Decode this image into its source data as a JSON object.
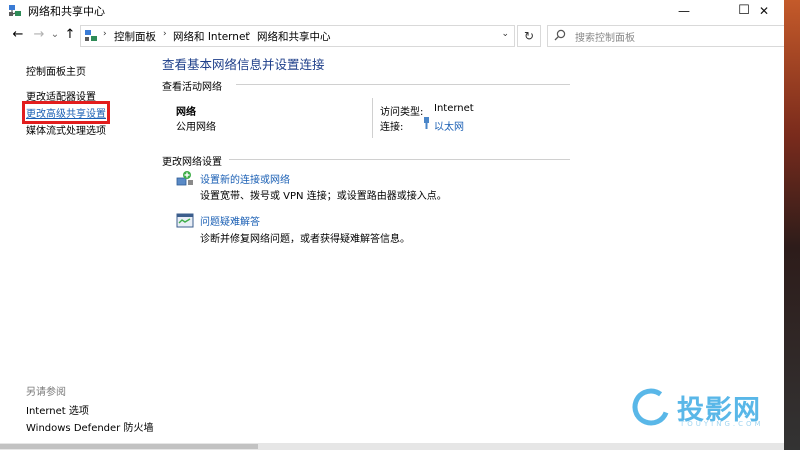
{
  "window": {
    "title": "网络和共享中心"
  },
  "controls": {
    "minimize": "—",
    "maximize": "☐",
    "close": "✕"
  },
  "nav": {
    "back": "←",
    "forward": "→",
    "history": "⌄",
    "up": "↑"
  },
  "address": {
    "crumbs": [
      "控制面板",
      "网络和 Internet",
      "网络和共享中心"
    ],
    "separator": "›",
    "dropdown": "⌄",
    "refresh": "↻"
  },
  "search": {
    "placeholder": "搜索控制面板"
  },
  "left": {
    "links": [
      "控制面板主页",
      "更改适配器设置",
      "更改高级共享设置",
      "媒体流式处理选项"
    ],
    "see_also_title": "另请参阅",
    "see_also": [
      "Internet 选项",
      "Windows Defender 防火墙"
    ]
  },
  "main": {
    "title": "查看基本网络信息并设置连接",
    "active_title": "查看活动网络",
    "network_name": "网络",
    "network_type": "公用网络",
    "access_label": "访问类型:",
    "access_value": "Internet",
    "connection_label": "连接:",
    "connection_value": "以太网",
    "change_title": "更改网络设置",
    "tasks": [
      {
        "icon": "new-connection-icon",
        "title": "设置新的连接或网络",
        "desc": "设置宽带、拨号或 VPN 连接；或设置路由器或接入点。"
      },
      {
        "icon": "troubleshoot-icon",
        "title": "问题疑难解答",
        "desc": "诊断并修复网络问题，或者获得疑难解答信息。"
      }
    ]
  },
  "watermark": {
    "text": "投影网",
    "sub": "TOUYING.COM",
    "color": "#59b7e8"
  }
}
